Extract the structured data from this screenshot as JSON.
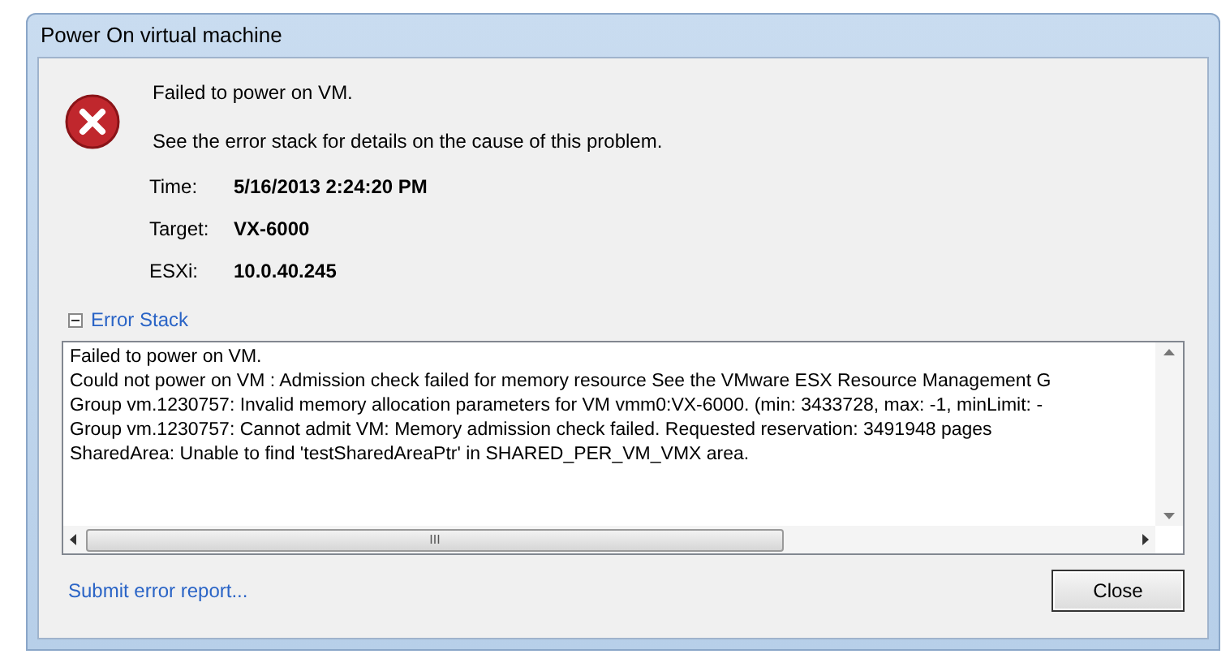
{
  "window": {
    "title": "Power On virtual machine"
  },
  "message": {
    "heading": "Failed to power on VM.",
    "detail": "See the error stack for details on the cause of this problem."
  },
  "details": [
    {
      "label": "Time:",
      "value": "5/16/2013 2:24:20 PM"
    },
    {
      "label": "Target:",
      "value": "VX-6000"
    },
    {
      "label": "ESXi:",
      "value": "10.0.40.245"
    }
  ],
  "error_stack": {
    "label": "Error Stack",
    "expanded": true,
    "lines": [
      "Failed to power on VM.",
      "Could not power on VM : Admission check failed for memory resource See the VMware ESX Resource Management G",
      "Group vm.1230757: Invalid memory allocation parameters for VM vmm0:VX-6000. (min: 3433728, max: -1, minLimit: -",
      "Group vm.1230757: Cannot admit VM: Memory admission check failed. Requested reservation: 3491948 pages",
      "SharedArea: Unable to find 'testSharedAreaPtr' in SHARED_PER_VM_VMX area."
    ],
    "scrollbar_thumb": "III"
  },
  "footer": {
    "link": "Submit error report...",
    "button": "Close"
  }
}
